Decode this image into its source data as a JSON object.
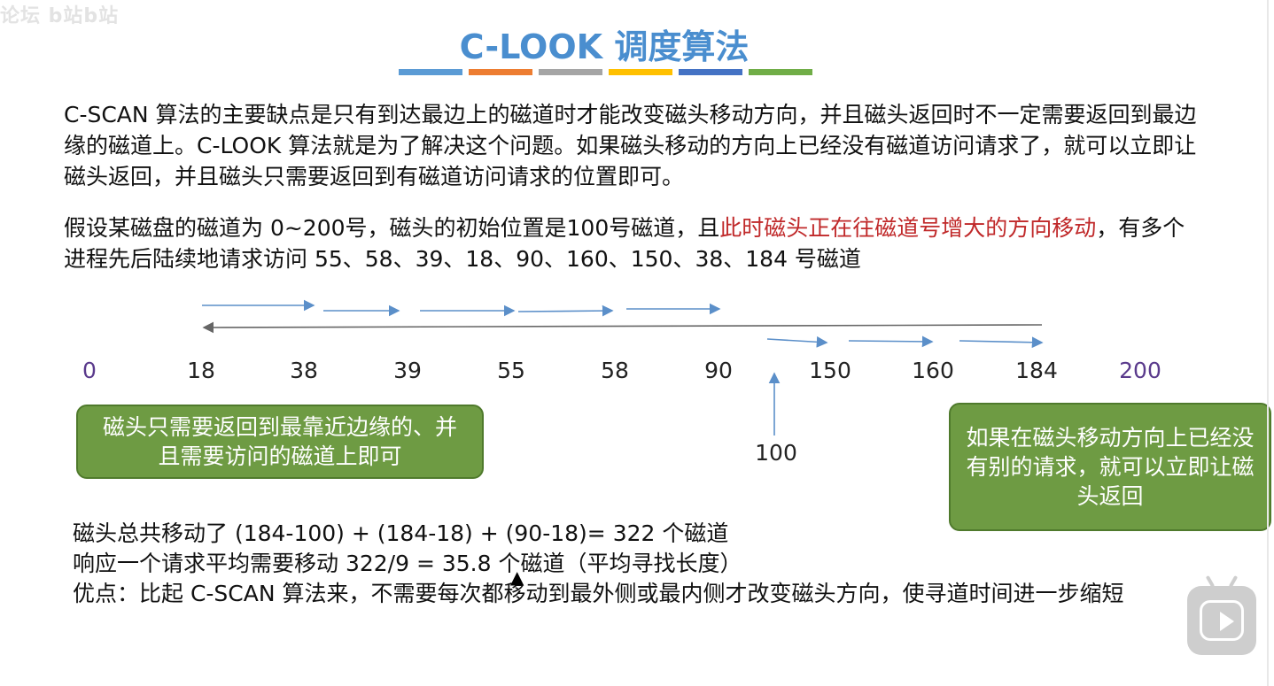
{
  "watermark": "论坛 b站b站",
  "title": "C-LOOK 调度算法",
  "title_bar_colors": [
    "#5b9bd5",
    "#ed7d31",
    "#a5a5a5",
    "#ffc000",
    "#4472c4",
    "#70ad47"
  ],
  "para1": "C-SCAN 算法的主要缺点是只有到达最边上的磁道时才能改变磁头移动方向，并且磁头返回时不一定需要返回到最边缘的磁道上。C-LOOK 算法就是为了解决这个问题。如果磁头移动的方向上已经没有磁道访问请求了，就可以立即让磁头返回，并且磁头只需要返回到有磁道访问请求的位置即可。",
  "para2": {
    "before": "假设某磁盘的磁道为 0~200号，磁头的初始位置是100号磁道，且",
    "red": "此时磁头正在往磁道号增大的方向移动",
    "after": "，有多个进程先后陆续地请求访问 55、58、39、18、90、160、150、38、184 号磁道"
  },
  "ticks": [
    "0",
    "18",
    "38",
    "39",
    "55",
    "58",
    "90",
    "150",
    "160",
    "184",
    "200"
  ],
  "start_label": "100",
  "callout_left": "磁头只需要返回到最靠近边缘的、并且需要访问的磁道上即可",
  "callout_right": "如果在磁头移动方向上已经没有别的请求，就可以立即让磁头返回",
  "summary": {
    "line1": "磁头总共移动了  (184-100) + (184-18) + (90-18)= 322 个磁道",
    "line2": "响应一个请求平均需要移动 322/9 = 35.8 个磁道（平均寻找长度）",
    "line3": "优点：比起 C-SCAN 算法来，不需要每次都移动到最外侧或最内侧才改变磁头方向，使寻道时间进一步缩短"
  },
  "colors": {
    "title": "#4a8ecf",
    "arrow": "#5b8fc9",
    "return_line": "#666666",
    "callout": "#6e9b43",
    "red": "#c0292a"
  },
  "icons": {
    "player": "play-icon",
    "cursor": "mouse-cursor-icon"
  }
}
